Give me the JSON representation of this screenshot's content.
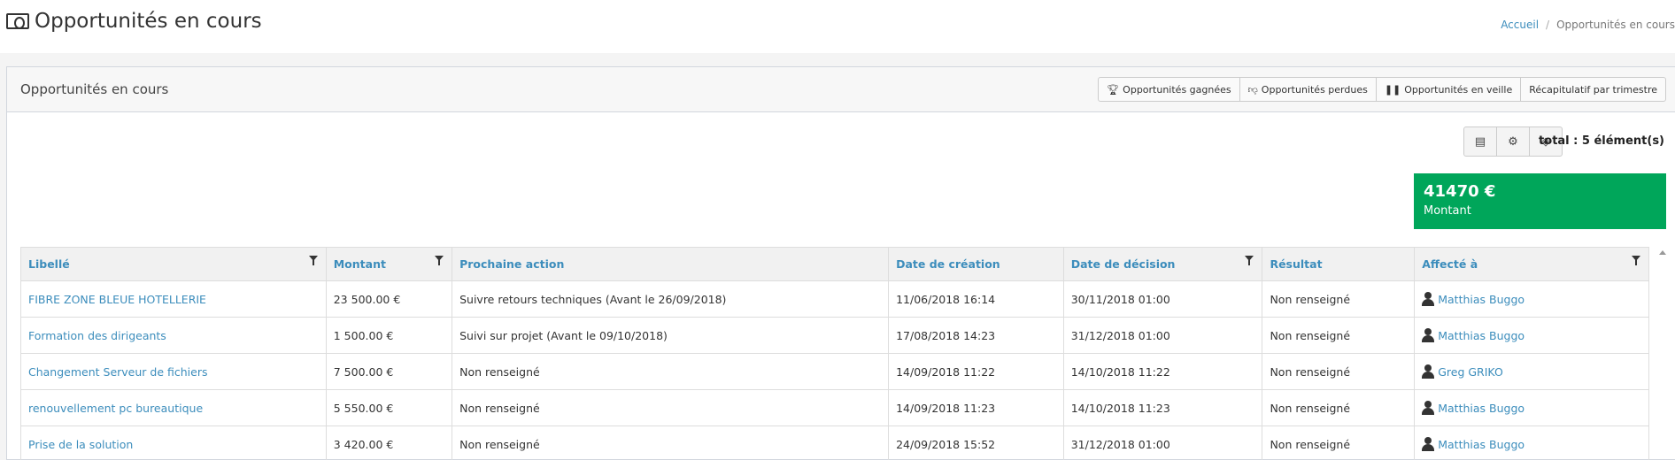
{
  "header": {
    "title": "Opportunités en cours",
    "breadcrumb": {
      "home": "Accueil",
      "separator": "/",
      "current": "Opportunités en cours"
    }
  },
  "box": {
    "title": "Opportunités en cours",
    "buttons": {
      "won": "Opportunités gagnées",
      "lost": "Opportunités perdues",
      "standby": "Opportunités en veille",
      "quarterly": "Récapitulatif par trimestre"
    }
  },
  "tools": {
    "total": "total : 5 élément(s)"
  },
  "kpi": {
    "value": "41470 €",
    "label": "Montant",
    "color": "#00a65a"
  },
  "table": {
    "headers": {
      "label": "Libellé",
      "amount": "Montant",
      "next_action": "Prochaine action",
      "created": "Date de création",
      "decision": "Date de décision",
      "result": "Résultat",
      "assigned": "Affecté à"
    },
    "rows": [
      [
        "FIBRE ZONE BLEUE HOTELLERIE",
        "23 500.00 €",
        "Suivre retours techniques (Avant le 26/09/2018)",
        "11/06/2018 16:14",
        "30/11/2018 01:00",
        "Non renseigné",
        "Matthias Buggo"
      ],
      [
        "Formation des dirigeants",
        "1 500.00 €",
        "Suivi sur projet (Avant le 09/10/2018)",
        "17/08/2018 14:23",
        "31/12/2018 01:00",
        "Non renseigné",
        "Matthias Buggo"
      ],
      [
        "Changement Serveur de fichiers",
        "7 500.00 €",
        "Non renseigné",
        "14/09/2018 11:22",
        "14/10/2018 11:22",
        "Non renseigné",
        "Greg GRIKO"
      ],
      [
        "renouvellement pc bureautique",
        "5 550.00 €",
        "Non renseigné",
        "14/09/2018 11:23",
        "14/10/2018 11:23",
        "Non renseigné",
        "Matthias Buggo"
      ],
      [
        "Prise de la solution",
        "3 420.00 €",
        "Non renseigné",
        "24/09/2018 15:52",
        "31/12/2018 01:00",
        "Non renseigné",
        "Matthias Buggo"
      ]
    ]
  },
  "colors": {
    "link": "#3c8dbc",
    "success": "#00a65a"
  }
}
